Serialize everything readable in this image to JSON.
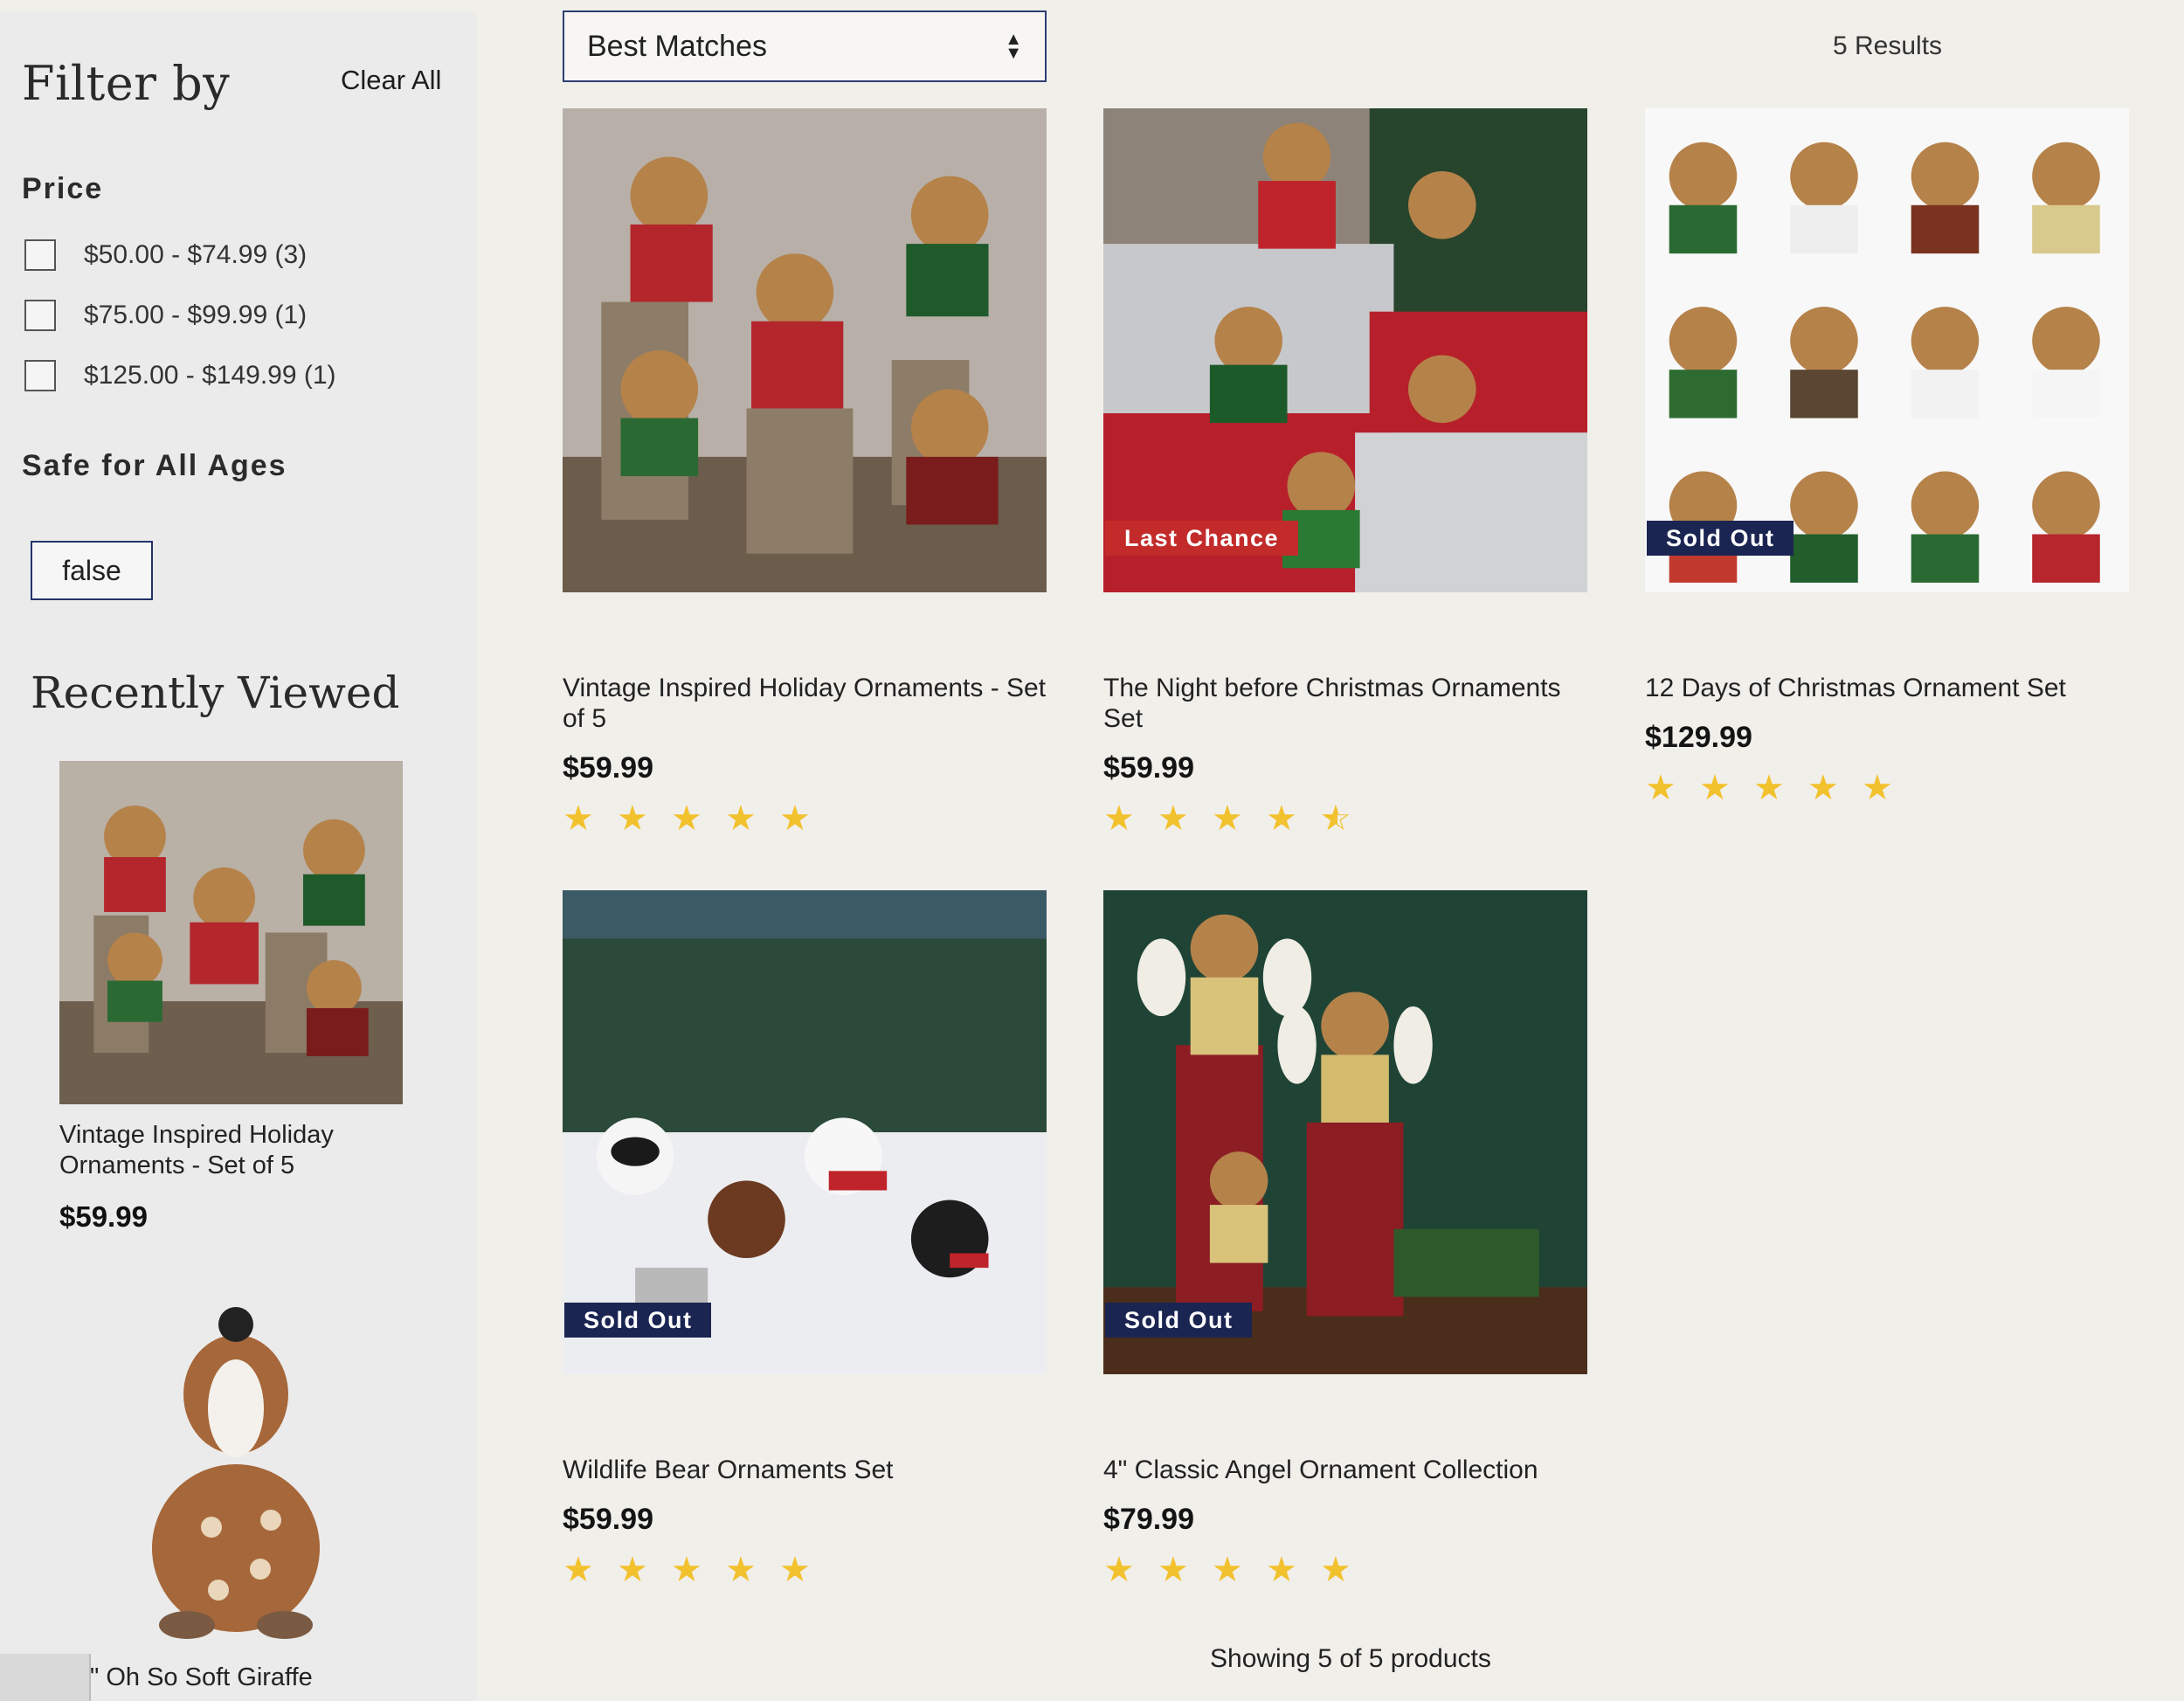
{
  "filters": {
    "title": "Filter by",
    "clear_all": "Clear All",
    "price": {
      "title": "Price",
      "options": [
        {
          "label": "$50.00 - $74.99 (3)",
          "checked": false
        },
        {
          "label": "$75.00 - $99.99 (1)",
          "checked": false
        },
        {
          "label": "$125.00 - $149.99 (1)",
          "checked": false
        }
      ]
    },
    "safe": {
      "title": "Safe for All Ages",
      "selected": "false"
    }
  },
  "recently_viewed": {
    "title": "Recently Viewed",
    "items": [
      {
        "name": "Vintage Inspired Holiday Ornaments - Set of 5",
        "price": "$59.99"
      },
      {
        "name": "\" Oh So Soft Giraffe"
      }
    ]
  },
  "sort": {
    "value": "Best Matches"
  },
  "results": {
    "count_label": "5 Results",
    "showing": "Showing 5 of 5 products"
  },
  "products": [
    {
      "name": "Vintage Inspired Holiday Ornaments - Set of 5",
      "price": "$59.99",
      "rating": 5,
      "badge": ""
    },
    {
      "name": "The Night before Christmas Ornaments Set",
      "price": "$59.99",
      "rating": 4.5,
      "badge": "Last Chance"
    },
    {
      "name": "12 Days of Christmas Ornament Set",
      "price": "$129.99",
      "rating": 5,
      "badge": "Sold Out"
    },
    {
      "name": "Wildlife Bear Ornaments Set",
      "price": "$59.99",
      "rating": 5,
      "badge": "Sold Out"
    },
    {
      "name": "4\" Classic Angel Ornament Collection",
      "price": "$79.99",
      "rating": 5,
      "badge": "Sold Out"
    }
  ],
  "colors": {
    "accent_navy": "#1b2552",
    "badge_red": "#c32a2a",
    "star_gold": "#f2c12e",
    "page_bg": "#f1efea",
    "sidebar_bg": "#ebebeb"
  }
}
